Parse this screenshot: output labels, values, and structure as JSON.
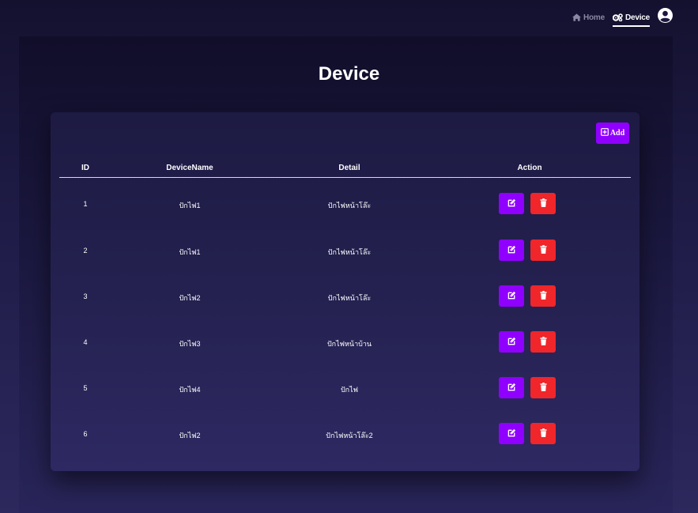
{
  "nav": {
    "home_label": "Home",
    "device_label": "Device",
    "home_icon": "home-icon",
    "device_icon": "gears-icon",
    "user_icon": "user-circle-icon"
  },
  "page": {
    "title": "Device"
  },
  "toolbar": {
    "add_label": "Add",
    "add_icon": "plus-square-icon"
  },
  "table": {
    "columns": [
      "ID",
      "DeviceName",
      "Detail",
      "Action"
    ],
    "rows": [
      {
        "id": "1",
        "name": "ปักไฟ1",
        "detail": "ปักไฟหน้าโล๊ะ"
      },
      {
        "id": "2",
        "name": "ปักไฟ1",
        "detail": "ปักไฟหน้าโล๊ะ"
      },
      {
        "id": "3",
        "name": "ปักไฟ2",
        "detail": "ปักไฟหน้าโล๊ะ"
      },
      {
        "id": "4",
        "name": "ปักไฟ3",
        "detail": "ปักไฟหน้าบ้าน"
      },
      {
        "id": "5",
        "name": "ปักไฟ4",
        "detail": "ปักไฟ"
      },
      {
        "id": "6",
        "name": "ปักไฟ2",
        "detail": "ปักไฟหน้าโล๊ะ2"
      }
    ],
    "action_icons": {
      "edit": "edit-icon",
      "delete": "trash-icon"
    }
  },
  "colors": {
    "accent_purple": "#9000ff",
    "danger_red": "#f0262a",
    "background": "#1f1c48"
  }
}
